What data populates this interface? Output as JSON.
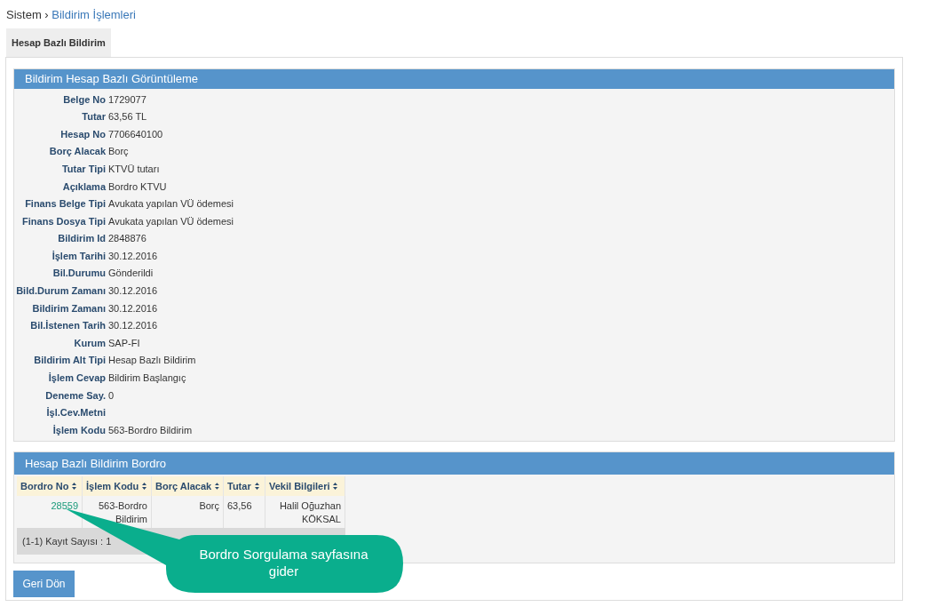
{
  "breadcrumb": {
    "root": "Sistem ›",
    "current": "Bildirim İşlemleri"
  },
  "tabs": [
    {
      "label": "Hesap Bazlı Bildirim",
      "selected": true
    }
  ],
  "details": {
    "title": "Bildirim Hesap Bazlı Görüntüleme",
    "fields": [
      {
        "label": "Belge No",
        "value": "1729077"
      },
      {
        "label": "Tutar",
        "value": "63,56 TL"
      },
      {
        "label": "Hesap No",
        "value": "7706640100"
      },
      {
        "label": "Borç Alacak",
        "value": "Borç"
      },
      {
        "label": "Tutar Tipi",
        "value": "KTVÜ tutarı"
      },
      {
        "label": "Açıklama",
        "value": "Bordro KTVU"
      },
      {
        "label": "Finans Belge Tipi",
        "value": "Avukata yapılan VÜ ödemesi"
      },
      {
        "label": "Finans Dosya Tipi",
        "value": "Avukata yapılan VÜ ödemesi"
      },
      {
        "label": "Bildirim Id",
        "value": "2848876"
      },
      {
        "label": "İşlem Tarihi",
        "value": "30.12.2016"
      },
      {
        "label": "Bil.Durumu",
        "value": "Gönderildi"
      },
      {
        "label": "Bild.Durum Zamanı",
        "value": "30.12.2016"
      },
      {
        "label": "Bildirim Zamanı",
        "value": "30.12.2016"
      },
      {
        "label": "Bil.İstenen Tarih",
        "value": "30.12.2016"
      },
      {
        "label": "Kurum",
        "value": "SAP-FI"
      },
      {
        "label": "Bildirim Alt Tipi",
        "value": "Hesap Bazlı Bildirim"
      },
      {
        "label": "İşlem Cevap",
        "value": "Bildirim Başlangıç"
      },
      {
        "label": "Deneme Say.",
        "value": "0"
      },
      {
        "label": "İşl.Cev.Metni"
      },
      {
        "label": "İşlem Kodu",
        "value": "563-Bordro Bildirim"
      }
    ]
  },
  "bordro": {
    "title": "Hesap Bazlı Bildirim Bordro",
    "table": {
      "columns": [
        "Bordro No",
        "İşlem Kodu",
        "Borç Alacak",
        "Tutar",
        "Vekil Bilgileri"
      ],
      "rows": [
        [
          "28559",
          "563-Bordro Bildirim",
          "Borç",
          "63,56",
          "Halil Oğuzhan KÖKSAL"
        ]
      ],
      "footer": "(1-1) Kayıt Sayısı : 1"
    }
  },
  "buttons": [
    "Geri Dön"
  ],
  "callout": {
    "text": "Bordro Sorgulama sayfasına gider"
  }
}
